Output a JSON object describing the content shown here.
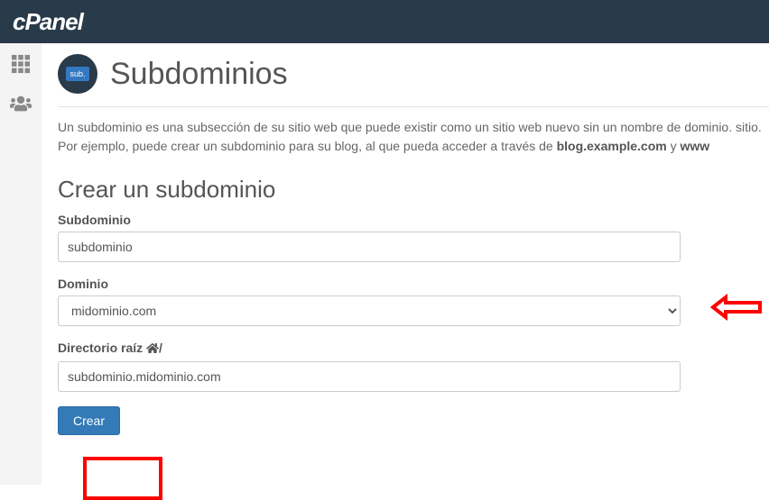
{
  "brand": "cPanel",
  "page": {
    "title": "Subdominios",
    "icon_label": "sub."
  },
  "description": {
    "text_pre": "Un subdominio es una subsección de su sitio web que puede existir como un sitio web nuevo sin un nombre de dominio. sitio. Por ejemplo, puede crear un subdominio para su blog, al que pueda acceder a través de ",
    "bold1": "blog.example.com",
    "mid": " y ",
    "bold2": "www"
  },
  "form": {
    "heading": "Crear un subdominio",
    "subdomain_label": "Subdominio",
    "subdomain_value": "subdominio",
    "domain_label": "Dominio",
    "domain_value": "midominio.com",
    "root_label_pre": "Directorio raíz ",
    "root_label_suffix": "/",
    "root_value": "subdominio.midominio.com",
    "submit_label": "Crear"
  }
}
